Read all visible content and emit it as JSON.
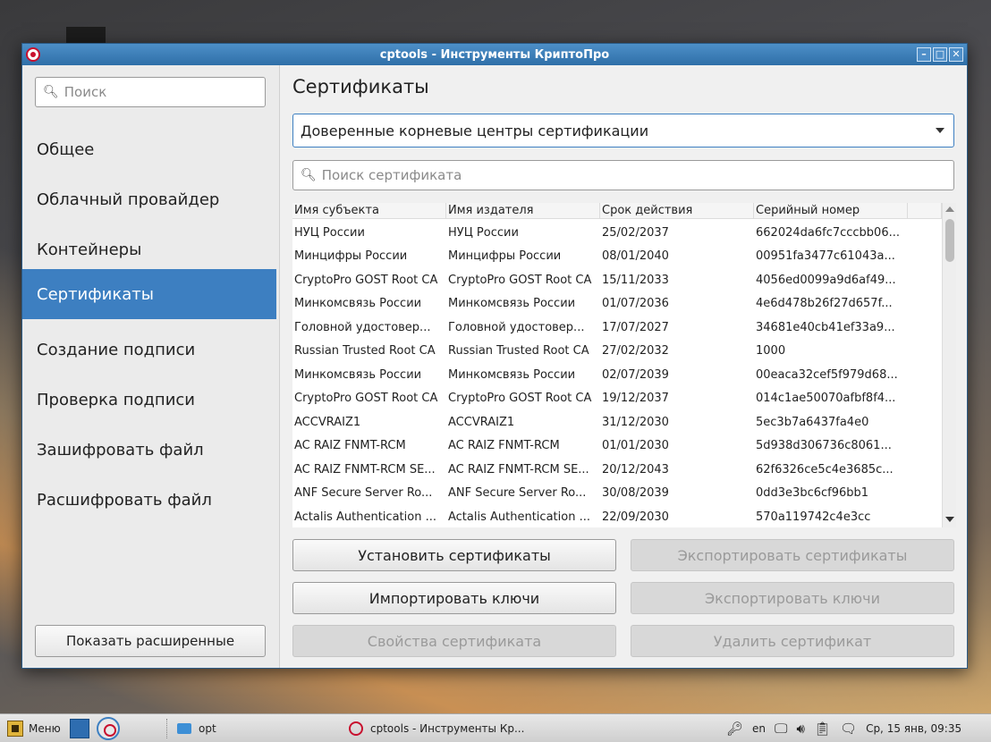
{
  "window": {
    "title": "cptools - Инструменты КриптоПро"
  },
  "sidebar": {
    "search_placeholder": "Поиск",
    "items": [
      {
        "label": "Общее",
        "active": false
      },
      {
        "label": "Облачный провайдер",
        "active": false
      },
      {
        "label": "Контейнеры",
        "active": false
      },
      {
        "label": "Сертификаты",
        "active": true
      },
      {
        "label": "Создание подписи",
        "active": false
      },
      {
        "label": "Проверка подписи",
        "active": false
      },
      {
        "label": "Зашифровать файл",
        "active": false
      },
      {
        "label": "Расшифровать файл",
        "active": false
      }
    ],
    "advanced_button": "Показать расширенные"
  },
  "main": {
    "title": "Сертификаты",
    "store_selected": "Доверенные корневые центры сертификации",
    "cert_search_placeholder": "Поиск сертификата",
    "table": {
      "columns": [
        "Имя субъекта",
        "Имя издателя",
        "Срок действия",
        "Серийный номер"
      ],
      "rows": [
        [
          "НУЦ России",
          "НУЦ России",
          "25/02/2037",
          "662024da6fc7cccbb06..."
        ],
        [
          "Минцифры России",
          "Минцифры России",
          "08/01/2040",
          "00951fa3477c61043a..."
        ],
        [
          "CryptoPro GOST Root CA",
          "CryptoPro GOST Root CA",
          "15/11/2033",
          "4056ed0099a9d6af49..."
        ],
        [
          "Минкомсвязь России",
          "Минкомсвязь России",
          "01/07/2036",
          "4e6d478b26f27d657f..."
        ],
        [
          "Головной удостовер...",
          "Головной удостовер...",
          "17/07/2027",
          "34681e40cb41ef33a9..."
        ],
        [
          "Russian Trusted Root CA",
          "Russian Trusted Root CA",
          "27/02/2032",
          "1000"
        ],
        [
          "Минкомсвязь России",
          "Минкомсвязь России",
          "02/07/2039",
          "00eaca32cef5f979d68..."
        ],
        [
          "CryptoPro GOST Root CA",
          "CryptoPro GOST Root CA",
          "19/12/2037",
          "014c1ae50070afbf8f4..."
        ],
        [
          "ACCVRAIZ1",
          "ACCVRAIZ1",
          "31/12/2030",
          "5ec3b7a6437fa4e0"
        ],
        [
          "AC RAIZ FNMT-RCM",
          "AC RAIZ FNMT-RCM",
          "01/01/2030",
          "5d938d306736c8061..."
        ],
        [
          "AC RAIZ FNMT-RCM SE...",
          "AC RAIZ FNMT-RCM SE...",
          "20/12/2043",
          "62f6326ce5c4e3685c..."
        ],
        [
          "ANF Secure Server Ro...",
          "ANF Secure Server Ro...",
          "30/08/2039",
          "0dd3e3bc6cf96bb1"
        ],
        [
          "Actalis Authentication ...",
          "Actalis Authentication ...",
          "22/09/2030",
          "570a119742c4e3cc"
        ]
      ]
    },
    "buttons": {
      "install": "Установить сертификаты",
      "export_certs": "Экспортировать сертификаты",
      "import_keys": "Импортировать ключи",
      "export_keys": "Экспортировать ключи",
      "properties": "Свойства сертификата",
      "delete": "Удалить сертификат"
    }
  },
  "taskbar": {
    "menu_label": "Меню",
    "folder_label": "opt",
    "task_label": "cptools - Инструменты Кр...",
    "lang": "en",
    "clock": "Ср, 15 янв, 09:35"
  },
  "colors": {
    "accent": "#3d7fc1",
    "titlebar": "#3b7cb8"
  }
}
